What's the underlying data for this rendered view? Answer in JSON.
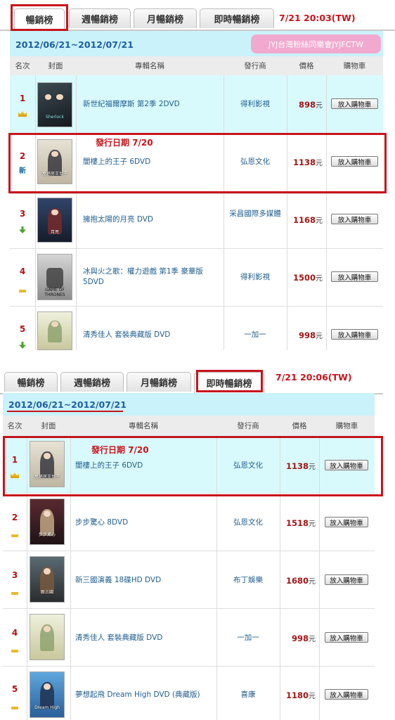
{
  "panel1": {
    "tabs": [
      "暢銷榜",
      "週暢銷榜",
      "月暢銷榜",
      "即時暢銷榜"
    ],
    "active_tab": "暢銷榜",
    "timestamp": "7/21 20:03(TW)",
    "date_range": "2012/06/21~2012/07/21",
    "watermark": "JYJ台灣粉絲同樂會JYJFCTW",
    "columns": [
      "名次",
      "封面",
      "專輯名稱",
      "發行商",
      "價格",
      "購物車"
    ],
    "release_note": "發行日期 7/20",
    "rows": [
      {
        "rank": "1",
        "trend_icon": "crown-icon",
        "trend_text": "",
        "album": "新世紀福爾摩斯 第2季 2DVD",
        "publisher": "得利影視",
        "price": "898",
        "unit": "元",
        "cart": "放入購物車",
        "highlight": true
      },
      {
        "rank": "2",
        "trend_icon": "",
        "trend_text": "新",
        "album": "闇樓上的王子 6DVD",
        "publisher": "弘恩文化",
        "price": "1138",
        "unit": "元",
        "cart": "放入購物車",
        "highlight": false
      },
      {
        "rank": "3",
        "trend_icon": "down-arrow-icon",
        "trend_text": "",
        "album": "擁抱太陽的月亮 DVD",
        "publisher": "采昌國際多媒體",
        "price": "1168",
        "unit": "元",
        "cart": "放入購物車",
        "highlight": false
      },
      {
        "rank": "4",
        "trend_icon": "flat-dash-icon",
        "trend_text": "",
        "album": "冰與火之歌：權力遊戲 第1季 豪華版 5DVD",
        "publisher": "得利影視",
        "price": "1500",
        "unit": "元",
        "cart": "放入購物車",
        "highlight": false
      },
      {
        "rank": "5",
        "trend_icon": "down-arrow-icon",
        "trend_text": "",
        "album": "清秀佳人 套裝典藏版 DVD",
        "publisher": "一加一",
        "price": "998",
        "unit": "元",
        "cart": "放入購物車",
        "highlight": false
      }
    ]
  },
  "panel2": {
    "tabs": [
      "暢銷榜",
      "週暢銷榜",
      "月暢銷榜",
      "即時暢銷榜"
    ],
    "active_tab": "即時暢銷榜",
    "timestamp": "7/21 20:06(TW)",
    "date_range": "2012/06/21~2012/07/21",
    "columns": [
      "名次",
      "封面",
      "專輯名稱",
      "發行商",
      "價格",
      "購物車"
    ],
    "release_note": "發行日期 7/20",
    "rows": [
      {
        "rank": "1",
        "trend_icon": "crown-icon",
        "trend_text": "",
        "album": "闇樓上的王子 6DVD",
        "publisher": "弘恩文化",
        "price": "1138",
        "unit": "元",
        "cart": "放入購物車",
        "highlight": true
      },
      {
        "rank": "2",
        "trend_icon": "flat-dash-icon",
        "trend_text": "",
        "album": "步步驚心 8DVD",
        "publisher": "弘恩文化",
        "price": "1518",
        "unit": "元",
        "cart": "放入購物車",
        "highlight": false
      },
      {
        "rank": "3",
        "trend_icon": "flat-dash-icon",
        "trend_text": "",
        "album": "新三國演義 18碟HD DVD",
        "publisher": "布丁娛樂",
        "price": "1680",
        "unit": "元",
        "cart": "放入購物車",
        "highlight": false
      },
      {
        "rank": "4",
        "trend_icon": "flat-dash-icon",
        "trend_text": "",
        "album": "清秀佳人 套裝典藏版 DVD",
        "publisher": "一加一",
        "price": "998",
        "unit": "元",
        "cart": "放入購物車",
        "highlight": false
      },
      {
        "rank": "5",
        "trend_icon": "flat-dash-icon",
        "trend_text": "",
        "album": "夢想起飛 Dream High DVD (典藏版)",
        "publisher": "喜康",
        "price": "1180",
        "unit": "元",
        "cart": "放入購物車",
        "highlight": false
      }
    ]
  },
  "colors": {
    "accent_red": "#c8141b",
    "date_bar": "#c9f2fa",
    "row_highlight": "#d9fafd",
    "link_blue": "#1f5d8e",
    "price_red": "#a31414",
    "watermark_pink": "#f1a9cf"
  }
}
